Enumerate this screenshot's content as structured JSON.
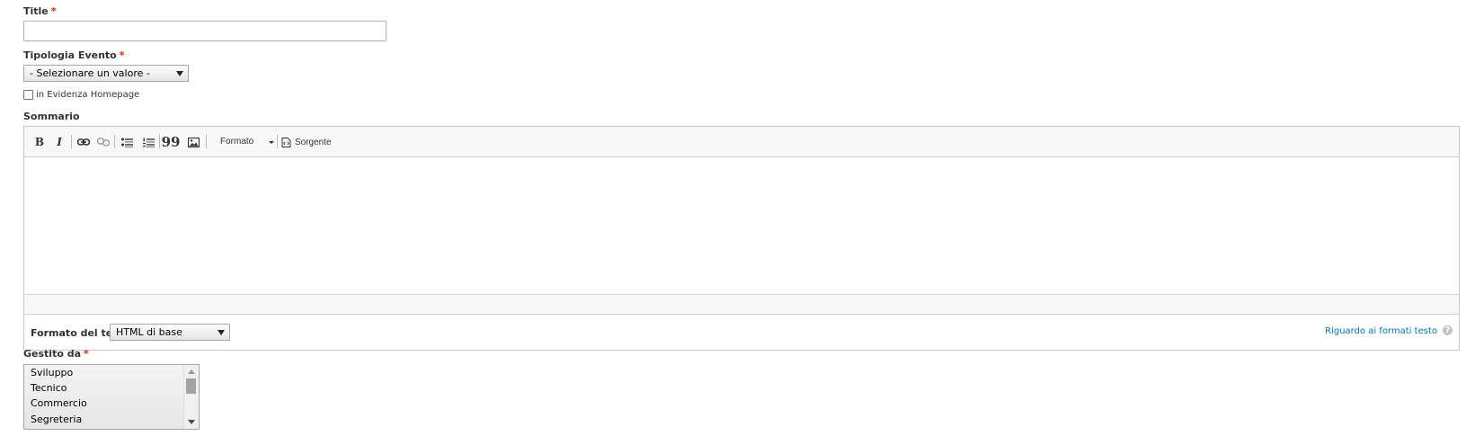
{
  "form": {
    "title": {
      "label": "Title",
      "required_mark": "*",
      "value": ""
    },
    "tipologia": {
      "label": "Tipologia Evento",
      "required_mark": "*",
      "selected": "- Selezionare un valore -"
    },
    "evidenza": {
      "label": "in Evidenza Homepage",
      "checked": false
    },
    "sommario": {
      "label": "Sommario",
      "toolbar": {
        "bold": "B",
        "italic": "I",
        "quote": "99",
        "format_dropdown": "Formato",
        "source": "Sorgente",
        "icons": [
          "bold-icon",
          "italic-icon",
          "link-icon",
          "unlink-icon",
          "bulleted-list-icon",
          "numbered-list-icon",
          "blockquote-icon",
          "image-icon",
          "source-icon"
        ]
      },
      "content": "",
      "text_format": {
        "label": "Formato del testo",
        "selected": "HTML di base",
        "about_link": "Riguardo ai formati testo",
        "help_glyph": "?"
      }
    },
    "gestito": {
      "label": "Gestito da",
      "required_mark": "*",
      "options": [
        "Sviluppo",
        "Tecnico",
        "Commercio",
        "Segreteria"
      ]
    }
  },
  "colors": {
    "required": "#e62600",
    "link": "#0074bd",
    "toolbar_bg": "#f8f8f8",
    "border": "#c8c8c8"
  }
}
